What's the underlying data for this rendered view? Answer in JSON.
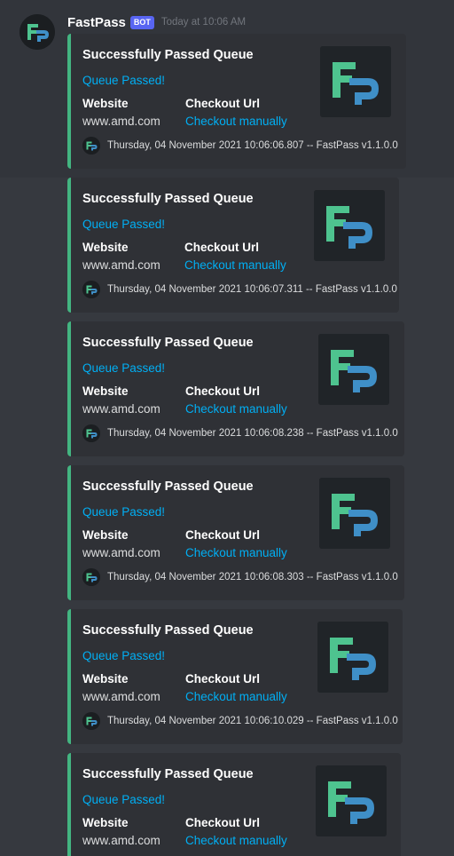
{
  "message": {
    "username": "FastPass",
    "bot_tag": "BOT",
    "timestamp": "Today at 10:06 AM",
    "avatar_icon": "fastpass-logo-icon"
  },
  "colors": {
    "background": "#36393f",
    "embed_bg": "#2f3136",
    "embed_border": "#43b581",
    "link": "#00aff4",
    "logo_green": "#4ec38f",
    "logo_blue": "#3f8fc7"
  },
  "embeds": [
    {
      "title": "Successfully Passed Queue",
      "description": "Queue Passed!",
      "fields": [
        {
          "name": "Website",
          "value": "www.amd.com"
        },
        {
          "name": "Checkout Url",
          "value": "Checkout manually"
        }
      ],
      "footer": "Thursday, 04 November 2021 10:06:06.807 -- FastPass v1.1.0.0"
    },
    {
      "title": "Successfully Passed Queue",
      "description": "Queue Passed!",
      "fields": [
        {
          "name": "Website",
          "value": "www.amd.com"
        },
        {
          "name": "Checkout Url",
          "value": "Checkout manually"
        }
      ],
      "footer": "Thursday, 04 November 2021 10:06:07.311 -- FastPass v1.1.0.0"
    },
    {
      "title": "Successfully Passed Queue",
      "description": "Queue Passed!",
      "fields": [
        {
          "name": "Website",
          "value": "www.amd.com"
        },
        {
          "name": "Checkout Url",
          "value": "Checkout manually"
        }
      ],
      "footer": "Thursday, 04 November 2021 10:06:08.238 -- FastPass v1.1.0.0"
    },
    {
      "title": "Successfully Passed Queue",
      "description": "Queue Passed!",
      "fields": [
        {
          "name": "Website",
          "value": "www.amd.com"
        },
        {
          "name": "Checkout Url",
          "value": "Checkout manually"
        }
      ],
      "footer": "Thursday, 04 November 2021 10:06:08.303 -- FastPass v1.1.0.0"
    },
    {
      "title": "Successfully Passed Queue",
      "description": "Queue Passed!",
      "fields": [
        {
          "name": "Website",
          "value": "www.amd.com"
        },
        {
          "name": "Checkout Url",
          "value": "Checkout manually"
        }
      ],
      "footer": "Thursday, 04 November 2021 10:06:10.029 -- FastPass v1.1.0.0"
    },
    {
      "title": "Successfully Passed Queue",
      "description": "Queue Passed!",
      "fields": [
        {
          "name": "Website",
          "value": "www.amd.com"
        },
        {
          "name": "Checkout Url",
          "value": "Checkout manually"
        }
      ]
    }
  ]
}
